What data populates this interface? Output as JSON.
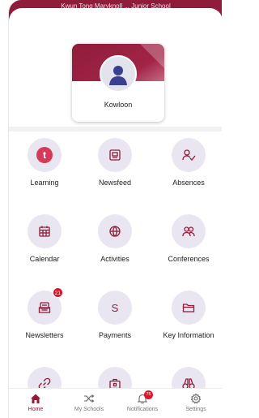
{
  "header": {
    "school_title": "Kwun Tong Maryknoll ... Junior School"
  },
  "school_card": {
    "name": "Kowloon"
  },
  "tiles": [
    {
      "label": "Learning",
      "icon": "learning-app-icon"
    },
    {
      "label": "Newsfeed",
      "icon": "newsfeed-icon"
    },
    {
      "label": "Absences",
      "icon": "absences-icon"
    },
    {
      "label": "Calendar",
      "icon": "calendar-icon"
    },
    {
      "label": "Activities",
      "icon": "activities-icon"
    },
    {
      "label": "Conferences",
      "icon": "conferences-icon"
    },
    {
      "label": "Newsletters",
      "icon": "newsletters-icon",
      "badge": "21"
    },
    {
      "label": "Payments",
      "icon": "payments-icon"
    },
    {
      "label": "Key Information",
      "icon": "folder-icon"
    },
    {
      "label": "",
      "icon": "link-icon"
    },
    {
      "label": "",
      "icon": "briefcase-icon"
    },
    {
      "label": "",
      "icon": "binoculars-icon"
    }
  ],
  "bottom_nav": {
    "items": [
      {
        "label": "Home",
        "icon": "home-icon",
        "active": true
      },
      {
        "label": "My Schools",
        "icon": "shuffle-icon"
      },
      {
        "label": "Notifications",
        "icon": "bell-icon",
        "badge": "75"
      },
      {
        "label": "Settings",
        "icon": "gear-icon"
      }
    ]
  },
  "colors": {
    "brand": "#8e1c3a",
    "tile_circle": "#e9e6f1",
    "badge": "#d8172b"
  }
}
